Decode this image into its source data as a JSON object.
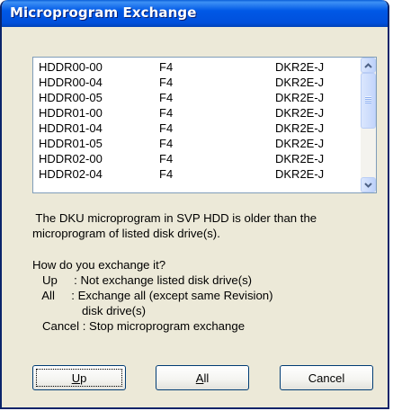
{
  "window": {
    "title": "Microprogram Exchange"
  },
  "drive_list": {
    "rows": [
      [
        "HDDR00-00",
        "F4",
        "DKR2E-J"
      ],
      [
        "HDDR00-04",
        "F4",
        "DKR2E-J"
      ],
      [
        "HDDR00-05",
        "F4",
        "DKR2E-J"
      ],
      [
        "HDDR01-00",
        "F4",
        "DKR2E-J"
      ],
      [
        "HDDR01-04",
        "F4",
        "DKR2E-J"
      ],
      [
        "HDDR01-05",
        "F4",
        "DKR2E-J"
      ],
      [
        "HDDR02-00",
        "F4",
        "DKR2E-J"
      ],
      [
        "HDDR02-04",
        "F4",
        "DKR2E-J"
      ]
    ]
  },
  "message": {
    "line1": " The DKU microprogram in SVP HDD is older than the",
    "line2": "microprogram of listed disk drive(s).",
    "question": "How do you exchange it?",
    "opt_up": "   Up     : Not exchange listed disk drive(s)",
    "opt_all_1": "   All     : Exchange all (except same Revision)",
    "opt_all_2": "               disk drive(s)",
    "opt_cancel": "   Cancel : Stop microprogram exchange"
  },
  "buttons": {
    "up": "Up",
    "all": "All",
    "cancel": "Cancel"
  },
  "icons": {
    "scroll_up": "chevron-up-icon",
    "scroll_down": "chevron-down-icon"
  },
  "colors": {
    "title_bar": "#0058e6",
    "dialog_bg": "#ece9d8",
    "button_border": "#003c74"
  }
}
